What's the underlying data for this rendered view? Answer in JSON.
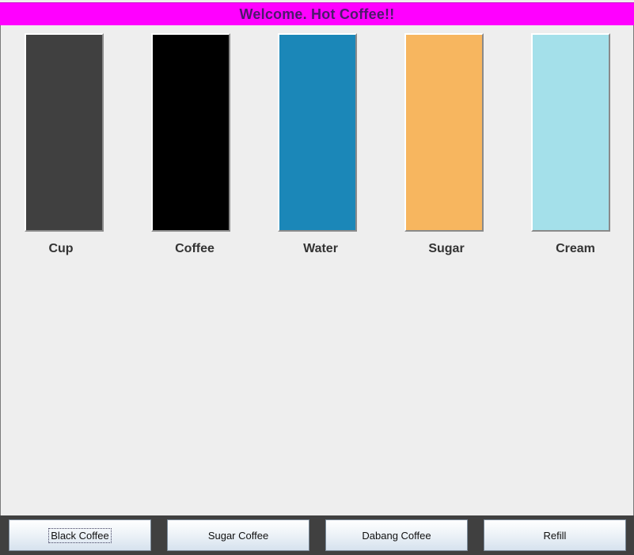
{
  "app": {
    "title": "Welcome. Hot Coffee!!",
    "title_color": "#4b1a6b",
    "banner_color": "#ff00ff"
  },
  "gauges": [
    {
      "label": "Cup",
      "level": 1.0,
      "color": "#404040"
    },
    {
      "label": "Coffee",
      "level": 1.0,
      "color": "#000000"
    },
    {
      "label": "Water",
      "level": 1.0,
      "color": "#1b87b8"
    },
    {
      "label": "Sugar",
      "level": 1.0,
      "color": "#f7b65f"
    },
    {
      "label": "Cream",
      "level": 1.0,
      "color": "#a4e0ea"
    }
  ],
  "buttons": [
    {
      "label": "Black Coffee",
      "focused": true
    },
    {
      "label": "Sugar Coffee",
      "focused": false
    },
    {
      "label": "Dabang Coffee",
      "focused": false
    },
    {
      "label": "Refill",
      "focused": false
    }
  ]
}
